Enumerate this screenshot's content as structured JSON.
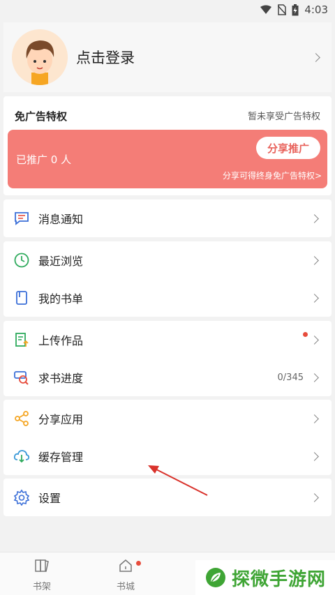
{
  "status_bar": {
    "time": "4:03",
    "icons": [
      "wifi-icon",
      "no-sim-icon",
      "battery-charging-icon"
    ]
  },
  "profile": {
    "login_label": "点击登录",
    "avatar": "avatar-cartoon-boy"
  },
  "ad_privilege": {
    "title": "免广告特权",
    "status": "暂未享受广告特权",
    "promoted_text": "已推广 0 人",
    "share_button": "分享推广",
    "share_tip": "分享可得终身免广告特权>"
  },
  "menu_groups": [
    [
      {
        "icon": "message-icon",
        "label": "消息通知"
      }
    ],
    [
      {
        "icon": "clock-icon",
        "label": "最近浏览"
      },
      {
        "icon": "bookmark-icon",
        "label": "我的书单"
      }
    ],
    [
      {
        "icon": "upload-icon",
        "label": "上传作品",
        "has_dot": true
      },
      {
        "icon": "search-book-icon",
        "label": "求书进度",
        "value": "0/345"
      }
    ],
    [
      {
        "icon": "share-icon",
        "label": "分享应用"
      },
      {
        "icon": "cloud-download-icon",
        "label": "缓存管理"
      }
    ],
    [
      {
        "icon": "settings-icon",
        "label": "设置"
      }
    ]
  ],
  "tabs": [
    {
      "icon": "bookshelf-icon",
      "label": "书架"
    },
    {
      "icon": "store-icon",
      "label": "书城",
      "has_dot": true
    }
  ],
  "watermark": {
    "text": "探微手游网"
  },
  "colors": {
    "ad_banner": "#f47d77",
    "accent_red": "#e74c3c",
    "watermark_green": "#3fa535"
  }
}
